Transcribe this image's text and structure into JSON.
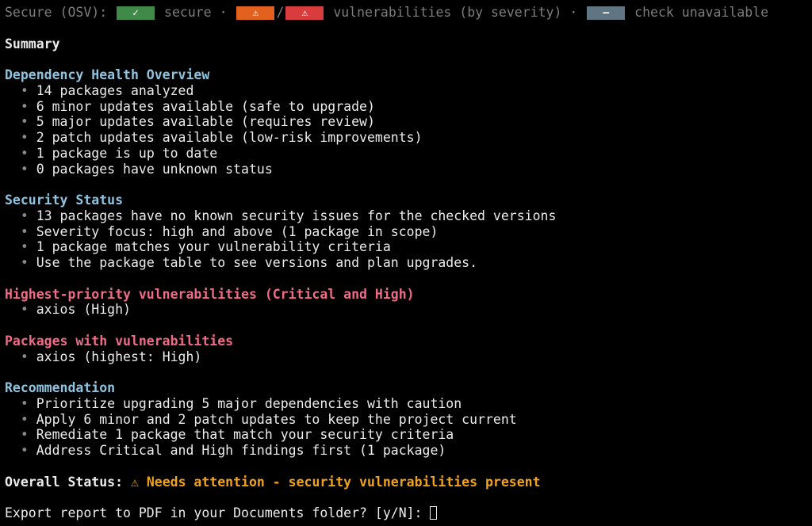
{
  "legend": {
    "label": "Secure (OSV):",
    "secure_icon": "✓",
    "secure_text": "secure",
    "sep1": "·",
    "warn_icon": "⚠",
    "slash": "/",
    "crit_icon": "⚠",
    "vuln_text": "vulnerabilities (by severity)",
    "sep2": "·",
    "na_icon": "—",
    "na_text": "check unavailable",
    "colors": {
      "secure": "#3f8a49",
      "warn": "#e2611f",
      "crit": "#d93c3c",
      "unavailable": "#5f7581"
    }
  },
  "summary_title": "Summary",
  "sections": {
    "health": {
      "title": "Dependency Health Overview",
      "items": [
        "14 packages analyzed",
        "6 minor updates available (safe to upgrade)",
        "5 major updates available (requires review)",
        "2 patch updates available (low-risk improvements)",
        "1 package is up to date",
        "0 packages have unknown status"
      ]
    },
    "security": {
      "title": "Security Status",
      "items": [
        "13 packages have no known security issues for the checked versions",
        "Severity focus: high and above (1 package in scope)",
        "1 package matches your vulnerability criteria",
        "Use the package table to see versions and plan upgrades."
      ]
    },
    "priority": {
      "title": "Highest-priority vulnerabilities (Critical and High)",
      "items": [
        "axios (High)"
      ]
    },
    "vulnerable": {
      "title": "Packages with vulnerabilities",
      "items": [
        "axios (highest: High)"
      ]
    },
    "recommendation": {
      "title": "Recommendation",
      "items": [
        "Prioritize upgrading 5 major dependencies with caution",
        "Apply 6 minor and 2 patch updates to keep the project current",
        "Remediate 1 package that match your security criteria",
        "Address Critical and High findings first (1 package)"
      ]
    }
  },
  "bullet": "•",
  "overall": {
    "label": "Overall Status:",
    "icon": "⚠",
    "value": "Needs attention - security vulnerabilities present"
  },
  "prompt": {
    "text": "Export report to PDF in your Documents folder? [y/N]:"
  },
  "colors": {
    "background": "#000000",
    "text": "#ececec",
    "heading_info": "#8ec4df",
    "heading_alert": "#ef6b86",
    "status_warning": "#f0a21f"
  }
}
